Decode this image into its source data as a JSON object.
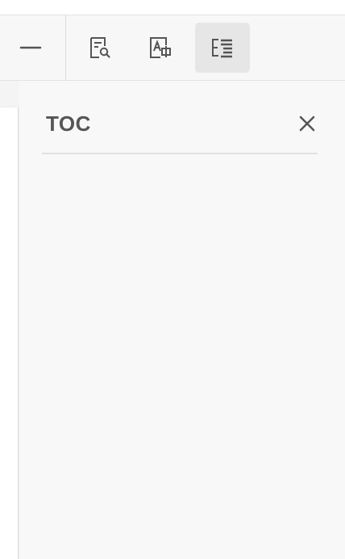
{
  "toolbar": {
    "buttons": [
      {
        "icon": "minus-icon"
      },
      {
        "icon": "document-search-icon"
      },
      {
        "icon": "image-add-icon"
      },
      {
        "icon": "table-of-contents-icon",
        "active": true
      }
    ]
  },
  "toc": {
    "title": "TOC",
    "close_icon": "close-icon"
  },
  "colors": {
    "panel_bg": "#f8f8f8",
    "toolbar_bg": "#f7f7f7",
    "active_button_bg": "#e6e6e6",
    "icon_color": "#555555"
  }
}
